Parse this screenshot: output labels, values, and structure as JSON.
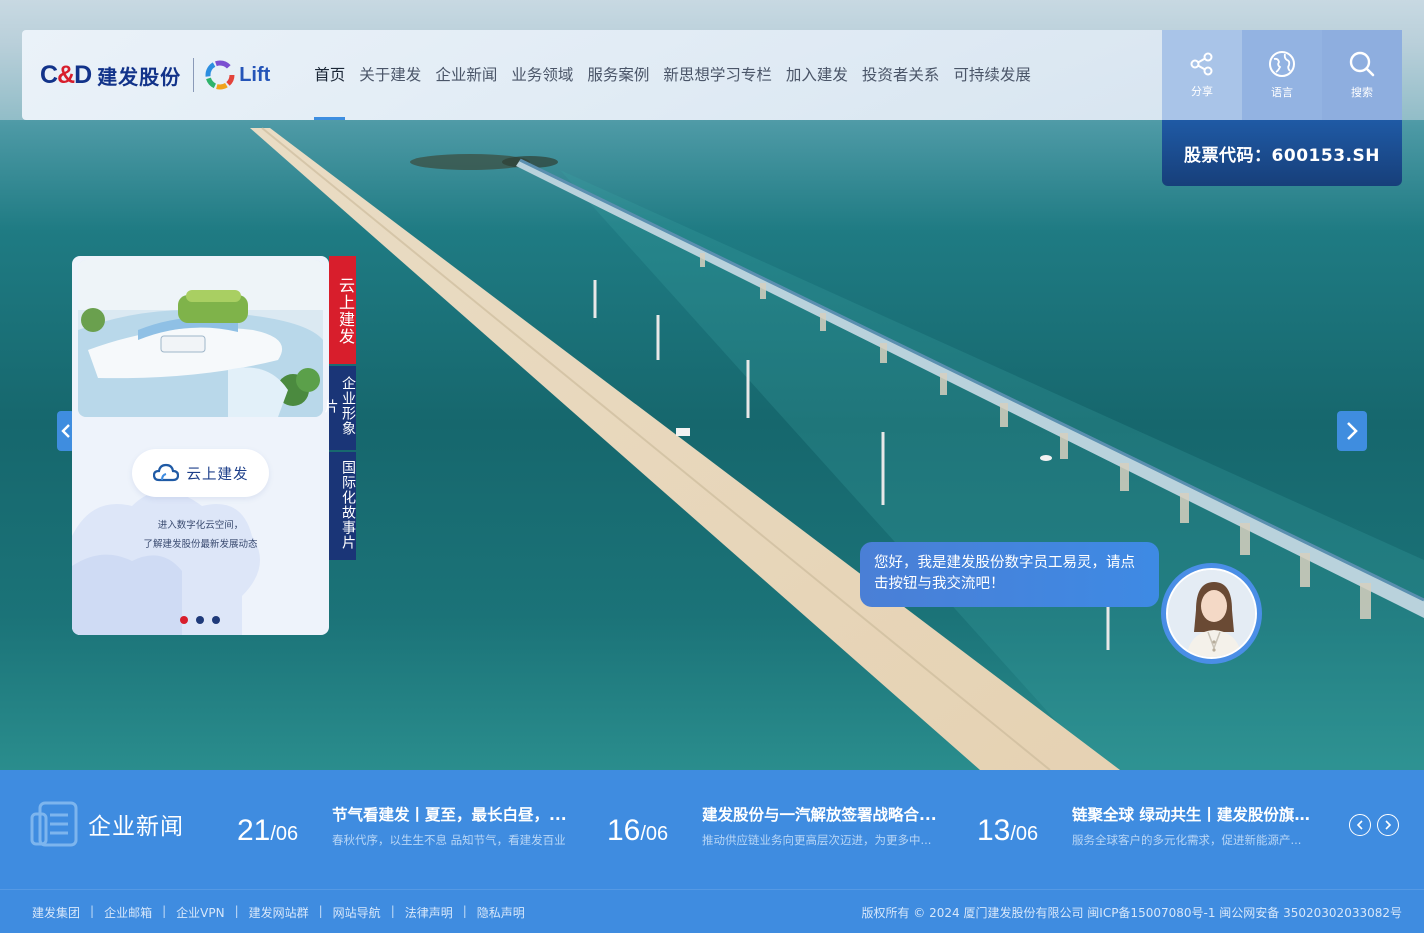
{
  "header": {
    "logo_cd": "C&D",
    "logo_cn": "建发股份",
    "logo_lift": "Lift",
    "nav": [
      "首页",
      "关于建发",
      "企业新闻",
      "业务领域",
      "服务案例",
      "新思想学习专栏",
      "加入建发",
      "投资者关系",
      "可持续发展"
    ],
    "active_nav": "首页",
    "tools": [
      {
        "label": "分享",
        "icon": "share-icon"
      },
      {
        "label": "语言",
        "icon": "globe-icon"
      },
      {
        "label": "搜索",
        "icon": "search-icon"
      }
    ],
    "stock": "股票代码：600153.SH"
  },
  "promo": {
    "button_label": "云上建发",
    "desc_line1": "进入数字化云空间，",
    "desc_line2": "了解建发股份最新发展动态",
    "tabs": [
      "云上建发",
      "企业形象片",
      "国际化故事片"
    ]
  },
  "assistant": {
    "message": "您好，我是建发股份数字员工易灵，请点击按钮与我交流吧！"
  },
  "news": {
    "section_title": "企业新闻",
    "items": [
      {
        "day": "21",
        "month": "/06",
        "title": "节气看建发丨夏至，最长白昼，...",
        "summary": "春秋代序，以生生不息 品知节气，看建发百业"
      },
      {
        "day": "16",
        "month": "/06",
        "title": "建发股份与一汽解放签署战略合...",
        "summary": "推动供应链业务向更高层次迈进，为更多中..."
      },
      {
        "day": "13",
        "month": "/06",
        "title": "链聚全球 绿动共生丨建发股份旗...",
        "summary": "服务全球客户的多元化需求，促进新能源产..."
      }
    ]
  },
  "footer": {
    "links": [
      "建发集团",
      "企业邮箱",
      "企业VPN",
      "建发网站群",
      "网站导航",
      "法律声明",
      "隐私声明"
    ],
    "copyright": "版权所有 © 2024 厦门建发股份有限公司 闽ICP备15007080号-1 闽公网安备 35020302033082号"
  },
  "colors": {
    "brand_navy": "#12338a",
    "brand_red": "#d81e2c",
    "accent_blue": "#3f8ce0"
  }
}
